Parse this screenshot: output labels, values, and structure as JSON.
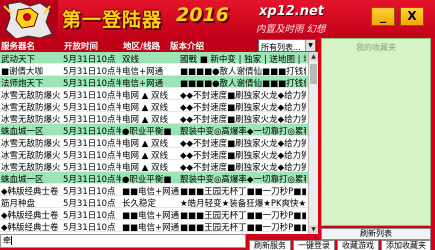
{
  "header": {
    "title": "第一登陆器",
    "year": "2016",
    "site": "xp12.net",
    "slogan": "内置及时雨 幻想",
    "min_label": "_",
    "close_label": "X"
  },
  "table": {
    "columns": [
      "服务器名",
      "开放时间",
      "地区/线路",
      "版本介绍"
    ],
    "filter_value": "所有列表...",
    "rows": [
      {
        "name": "武动天下",
        "time": "5月31日10点",
        "line": "双线",
        "desc": "國戰 ■ 新中变 | 独家 | 送地图 | 地图仙参 | 宝石"
      },
      {
        "name": "■谢倩大咖",
        "time": "5月31日10点半",
        "line": "电信+网通",
        "desc": "■■■■●散人谢倩仙■■■打钱就"
      },
      {
        "name": "法师炮天下",
        "time": "5月31日10点半",
        "line": "电信+网通",
        "desc": "■■■■●散人谢倩仙■■■打钱就"
      },
      {
        "name": "冰雪无敌防爆火龙",
        "time": "5月31日10点半",
        "line": "电网 ▲ 双线",
        "desc": "◆◆不封速度■刷独家火龙◆给力狮"
      },
      {
        "name": "冰雪无敌防爆火龙",
        "time": "5月31日10点半",
        "line": "电网 ▲ 双线",
        "desc": "◆◆不封速度■刷独家火龙◆给力狮"
      },
      {
        "name": "冰雪无敌防爆火龙",
        "time": "5月31日10点半",
        "line": "电网 ▲ 双线",
        "desc": "◆◆不封速度■刷独家火龙◆给力狮"
      },
      {
        "name": "蛛血城一区",
        "time": "5月31日10点半",
        "line": "●职业平衡■",
        "desc": "靓装中变◎高爆率◆一切靠打◎累积"
      },
      {
        "name": "冰雪无敌防爆火龙",
        "time": "5月31日10点半",
        "line": "电网 ▲ 双线",
        "desc": "◆◆不封速度■刷独家火龙◆给力狮"
      },
      {
        "name": "冰雪无敌防爆火龙",
        "time": "5月31日10点半",
        "line": "电网 ▲ 双线",
        "desc": "◆◆不封速度■刷独家火龙◆给力狮"
      },
      {
        "name": "冰雪无敌防爆火龙",
        "time": "5月31日10点半",
        "line": "电网 ▲ 双线",
        "desc": "◆◆不封速度■刷独家火龙◆给力狮"
      },
      {
        "name": "蛛血城一区",
        "time": "5月31日10点半",
        "line": "●职业平衡■",
        "desc": "靓装中变◎高爆率◆一切靠打◎累积"
      },
      {
        "name": "◆韩版经典士卷",
        "time": "5月31日10点",
        "line": "■■电信+网通■",
        "desc": "■■■王园无杯丁■■一刀秒P■■"
      },
      {
        "name": "筋月种盘",
        "time": "5月31日10点",
        "line": "长久稳定",
        "desc": "★皓月轻变★装备狂爆★PK爽快★经典毛"
      },
      {
        "name": "◆韩版经典士卷",
        "time": "5月31日10点",
        "line": "■■电信+网通■",
        "desc": "■■■王园无杯丁■■一刀秒P■■"
      },
      {
        "name": "◆韩版经典士卷",
        "time": "5月31日10点",
        "line": "■■电信+网通■",
        "desc": "■■■王园无杯丁■■一刀秒P■■"
      },
      {
        "name": "◆韩版经典士卷",
        "time": "5月31日10点",
        "line": "■■电信+网通■",
        "desc": "■■■王园无杯丁■■一刀秒P■■"
      }
    ]
  },
  "right_panel": {
    "placeholder": "我的收藏夹",
    "refresh_label": "刷新列表"
  },
  "bottom": {
    "input_value": "牵",
    "buttons": [
      "刷新服务",
      "一键登录",
      "收藏游戏",
      "添加收藏夹"
    ]
  }
}
